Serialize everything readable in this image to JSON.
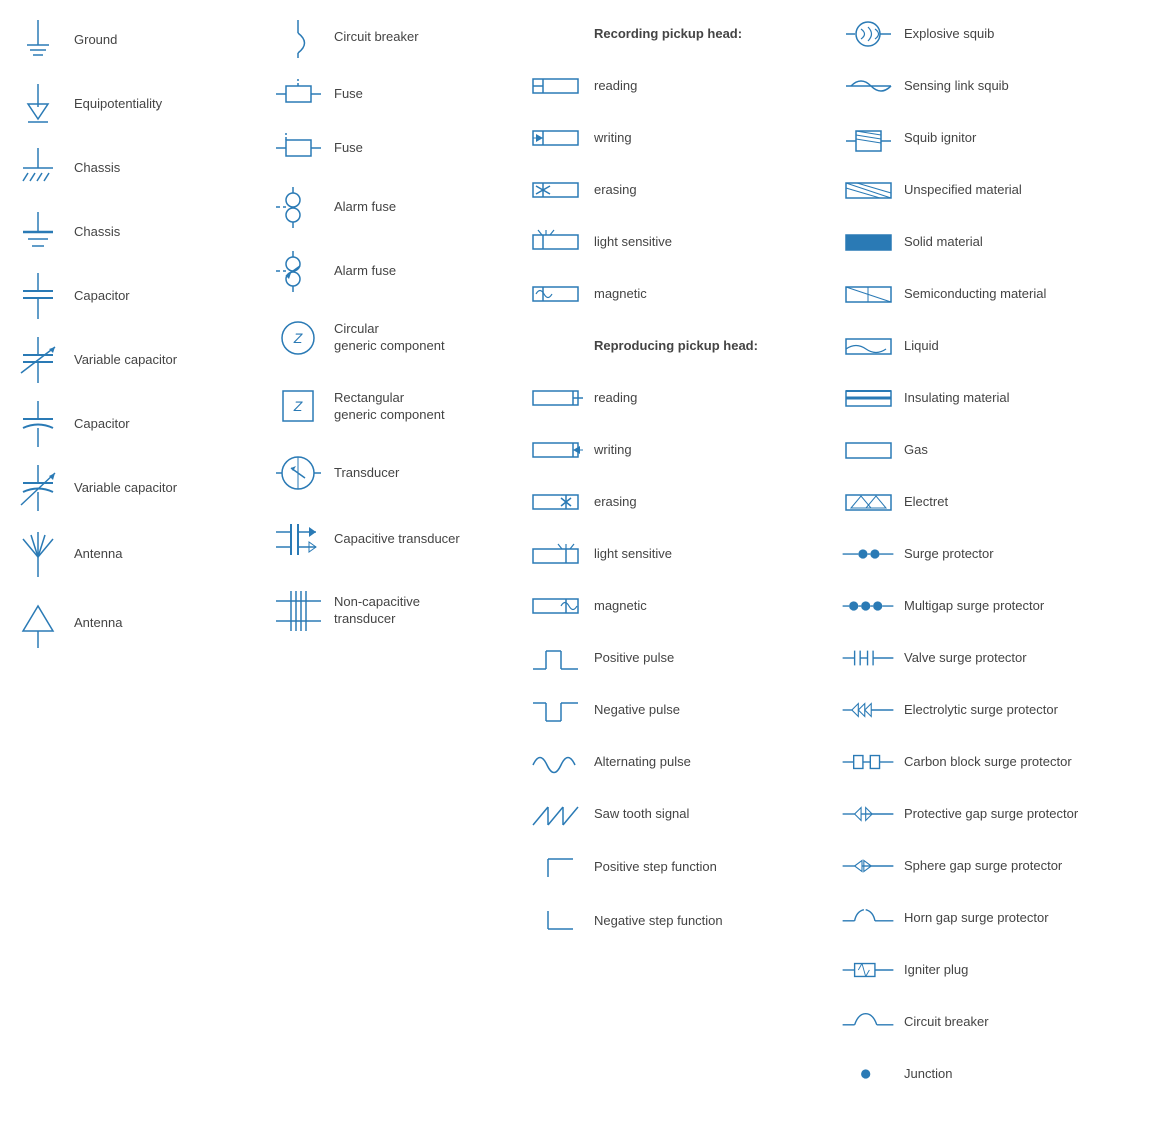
{
  "columns": [
    {
      "id": "col1",
      "items": [
        {
          "id": "ground",
          "label": "Ground",
          "symbol": "ground"
        },
        {
          "id": "equipotentiality",
          "label": "Equipotentiality",
          "symbol": "equipotentiality"
        },
        {
          "id": "chassis1",
          "label": "Chassis",
          "symbol": "chassis1"
        },
        {
          "id": "chassis2",
          "label": "Chassis",
          "symbol": "chassis2"
        },
        {
          "id": "capacitor1",
          "label": "Capacitor",
          "symbol": "capacitor1"
        },
        {
          "id": "variable-capacitor1",
          "label": "Variable capacitor",
          "symbol": "variable-capacitor1"
        },
        {
          "id": "capacitor2",
          "label": "Capacitor",
          "symbol": "capacitor2"
        },
        {
          "id": "variable-capacitor2",
          "label": "Variable capacitor",
          "symbol": "variable-capacitor2"
        },
        {
          "id": "antenna1",
          "label": "Antenna",
          "symbol": "antenna1"
        },
        {
          "id": "antenna2",
          "label": "Antenna",
          "symbol": "antenna2"
        }
      ]
    },
    {
      "id": "col2",
      "items": [
        {
          "id": "circuit-breaker",
          "label": "Circuit breaker",
          "symbol": "circuit-breaker"
        },
        {
          "id": "fuse1",
          "label": "Fuse",
          "symbol": "fuse1"
        },
        {
          "id": "fuse2",
          "label": "Fuse",
          "symbol": "fuse2"
        },
        {
          "id": "alarm-fuse1",
          "label": "Alarm fuse",
          "symbol": "alarm-fuse1"
        },
        {
          "id": "alarm-fuse2",
          "label": "Alarm fuse",
          "symbol": "alarm-fuse2"
        },
        {
          "id": "circular-generic",
          "label": "Circular\ngeneric component",
          "symbol": "circular-generic"
        },
        {
          "id": "rectangular-generic",
          "label": "Rectangular\ngeneric component",
          "symbol": "rectangular-generic"
        },
        {
          "id": "transducer",
          "label": "Transducer",
          "symbol": "transducer"
        },
        {
          "id": "capacitive-transducer",
          "label": "Capacitive transducer",
          "symbol": "capacitive-transducer"
        },
        {
          "id": "non-capacitive-transducer",
          "label": "Non-capacitive\ntransducer",
          "symbol": "non-capacitive-transducer"
        }
      ]
    },
    {
      "id": "col3",
      "items": [
        {
          "id": "recording-pickup-head",
          "label": "Recording pickup head:",
          "symbol": null
        },
        {
          "id": "reading1",
          "label": "reading",
          "symbol": "reading1"
        },
        {
          "id": "writing1",
          "label": "writing",
          "symbol": "writing1"
        },
        {
          "id": "erasing1",
          "label": "erasing",
          "symbol": "erasing1"
        },
        {
          "id": "light-sensitive1",
          "label": "light sensitive",
          "symbol": "light-sensitive1"
        },
        {
          "id": "magnetic1",
          "label": "magnetic",
          "symbol": "magnetic1"
        },
        {
          "id": "reproducing-pickup-head",
          "label": "Reproducing pickup head:",
          "symbol": null
        },
        {
          "id": "reading2",
          "label": "reading",
          "symbol": "reading2"
        },
        {
          "id": "writing2",
          "label": "writing",
          "symbol": "writing2"
        },
        {
          "id": "erasing2",
          "label": "erasing",
          "symbol": "erasing2"
        },
        {
          "id": "light-sensitive2",
          "label": "light sensitive",
          "symbol": "light-sensitive2"
        },
        {
          "id": "magnetic2",
          "label": "magnetic",
          "symbol": "magnetic2"
        },
        {
          "id": "positive-pulse",
          "label": "Positive pulse",
          "symbol": "positive-pulse"
        },
        {
          "id": "negative-pulse",
          "label": "Negative pulse",
          "symbol": "negative-pulse"
        },
        {
          "id": "alternating-pulse",
          "label": "Alternating pulse",
          "symbol": "alternating-pulse"
        },
        {
          "id": "saw-tooth",
          "label": "Saw tooth signal",
          "symbol": "saw-tooth"
        },
        {
          "id": "positive-step",
          "label": "Positive step function",
          "symbol": "positive-step"
        },
        {
          "id": "negative-step",
          "label": "Negative step function",
          "symbol": "negative-step"
        }
      ]
    },
    {
      "id": "col4",
      "items": [
        {
          "id": "explosive-squib",
          "label": "Explosive squib",
          "symbol": "explosive-squib"
        },
        {
          "id": "sensing-link-squib",
          "label": "Sensing link squib",
          "symbol": "sensing-link-squib"
        },
        {
          "id": "squib-ignitor",
          "label": "Squib ignitor",
          "symbol": "squib-ignitor"
        },
        {
          "id": "unspecified-material",
          "label": "Unspecified material",
          "symbol": "unspecified-material"
        },
        {
          "id": "solid-material",
          "label": "Solid material",
          "symbol": "solid-material"
        },
        {
          "id": "semiconducting-material",
          "label": "Semiconducting material",
          "symbol": "semiconducting-material"
        },
        {
          "id": "liquid",
          "label": "Liquid",
          "symbol": "liquid"
        },
        {
          "id": "insulating-material",
          "label": "Insulating material",
          "symbol": "insulating-material"
        },
        {
          "id": "gas",
          "label": "Gas",
          "symbol": "gas"
        },
        {
          "id": "electret",
          "label": "Electret",
          "symbol": "electret"
        },
        {
          "id": "surge-protector",
          "label": "Surge protector",
          "symbol": "surge-protector"
        },
        {
          "id": "multigap-surge",
          "label": "Multigap surge protector",
          "symbol": "multigap-surge"
        },
        {
          "id": "valve-surge",
          "label": "Valve surge protector",
          "symbol": "valve-surge"
        },
        {
          "id": "electrolytic-surge",
          "label": "Electrolytic surge protector",
          "symbol": "electrolytic-surge"
        },
        {
          "id": "carbon-block-surge",
          "label": "Carbon block surge protector",
          "symbol": "carbon-block-surge"
        },
        {
          "id": "protective-gap-surge",
          "label": "Protective gap surge protector",
          "symbol": "protective-gap-surge"
        },
        {
          "id": "sphere-gap-surge",
          "label": "Sphere gap surge protector",
          "symbol": "sphere-gap-surge"
        },
        {
          "id": "horn-gap-surge",
          "label": "Horn gap surge protector",
          "symbol": "horn-gap-surge"
        },
        {
          "id": "igniter-plug",
          "label": "Igniter plug",
          "symbol": "igniter-plug"
        },
        {
          "id": "circuit-breaker2",
          "label": "Circuit breaker",
          "symbol": "circuit-breaker2"
        },
        {
          "id": "junction",
          "label": "Junction",
          "symbol": "junction"
        }
      ]
    }
  ]
}
